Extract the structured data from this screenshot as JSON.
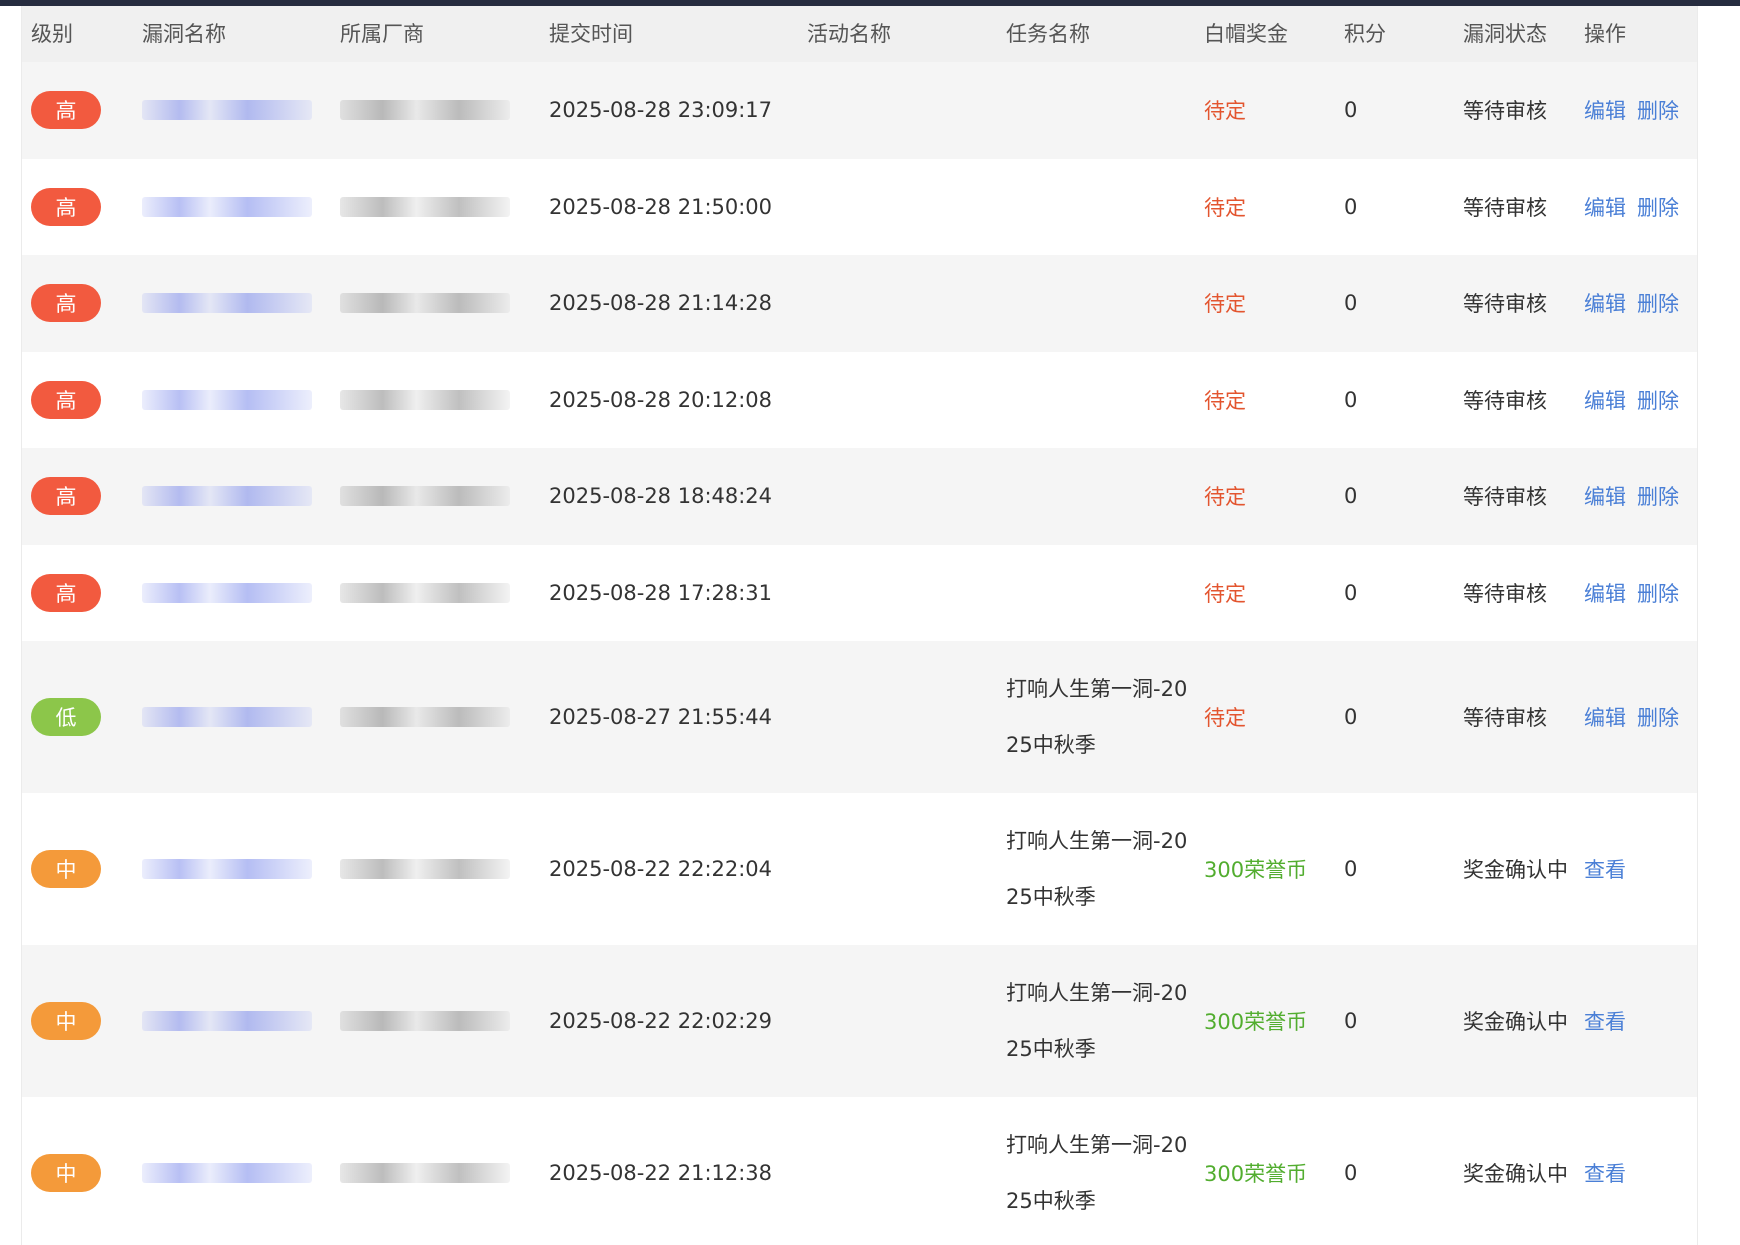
{
  "columns": {
    "level": "级别",
    "name": "漏洞名称",
    "vendor": "所属厂商",
    "time": "提交时间",
    "activity": "活动名称",
    "task": "任务名称",
    "bounty": "白帽奖金",
    "points": "积分",
    "status": "漏洞状态",
    "ops": "操作"
  },
  "colors": {
    "high": "#f25a3f",
    "low": "#8cc64a",
    "medium": "#f49a3a",
    "pending": "#e3552f",
    "coin": "#52ad2f",
    "link": "#4a7fd6"
  },
  "rows": [
    {
      "level": "高",
      "level_color": "high",
      "time": "2025-08-28 23:09:17",
      "activity": "",
      "task_line1": "",
      "task_line2": "",
      "bounty": "待定",
      "points": "0",
      "status": "等待审核",
      "op1": "编辑",
      "op2": "删除"
    },
    {
      "level": "高",
      "level_color": "high",
      "time": "2025-08-28 21:50:00",
      "activity": "",
      "task_line1": "",
      "task_line2": "",
      "bounty": "待定",
      "points": "0",
      "status": "等待审核",
      "op1": "编辑",
      "op2": "删除"
    },
    {
      "level": "高",
      "level_color": "high",
      "time": "2025-08-28 21:14:28",
      "activity": "",
      "task_line1": "",
      "task_line2": "",
      "bounty": "待定",
      "points": "0",
      "status": "等待审核",
      "op1": "编辑",
      "op2": "删除"
    },
    {
      "level": "高",
      "level_color": "high",
      "time": "2025-08-28 20:12:08",
      "activity": "",
      "task_line1": "",
      "task_line2": "",
      "bounty": "待定",
      "points": "0",
      "status": "等待审核",
      "op1": "编辑",
      "op2": "删除"
    },
    {
      "level": "高",
      "level_color": "high",
      "time": "2025-08-28 18:48:24",
      "activity": "",
      "task_line1": "",
      "task_line2": "",
      "bounty": "待定",
      "points": "0",
      "status": "等待审核",
      "op1": "编辑",
      "op2": "删除"
    },
    {
      "level": "高",
      "level_color": "high",
      "time": "2025-08-28 17:28:31",
      "activity": "",
      "task_line1": "",
      "task_line2": "",
      "bounty": "待定",
      "points": "0",
      "status": "等待审核",
      "op1": "编辑",
      "op2": "删除"
    },
    {
      "level": "低",
      "level_color": "low",
      "time": "2025-08-27 21:55:44",
      "activity": "",
      "task_line1": "打响人生第一洞-20",
      "task_line2": "25中秋季",
      "bounty": "待定",
      "points": "0",
      "status": "等待审核",
      "op1": "编辑",
      "op2": "删除"
    },
    {
      "level": "中",
      "level_color": "medium",
      "time": "2025-08-22 22:22:04",
      "activity": "",
      "task_line1": "打响人生第一洞-20",
      "task_line2": "25中秋季",
      "bounty": "300荣誉币",
      "points": "0",
      "status": "奖金确认中",
      "op1": "查看",
      "op2": ""
    },
    {
      "level": "中",
      "level_color": "medium",
      "time": "2025-08-22 22:02:29",
      "activity": "",
      "task_line1": "打响人生第一洞-20",
      "task_line2": "25中秋季",
      "bounty": "300荣誉币",
      "points": "0",
      "status": "奖金确认中",
      "op1": "查看",
      "op2": ""
    },
    {
      "level": "中",
      "level_color": "medium",
      "time": "2025-08-22 21:12:38",
      "activity": "",
      "task_line1": "打响人生第一洞-20",
      "task_line2": "25中秋季",
      "bounty": "300荣誉币",
      "points": "0",
      "status": "奖金确认中",
      "op1": "查看",
      "op2": ""
    }
  ]
}
